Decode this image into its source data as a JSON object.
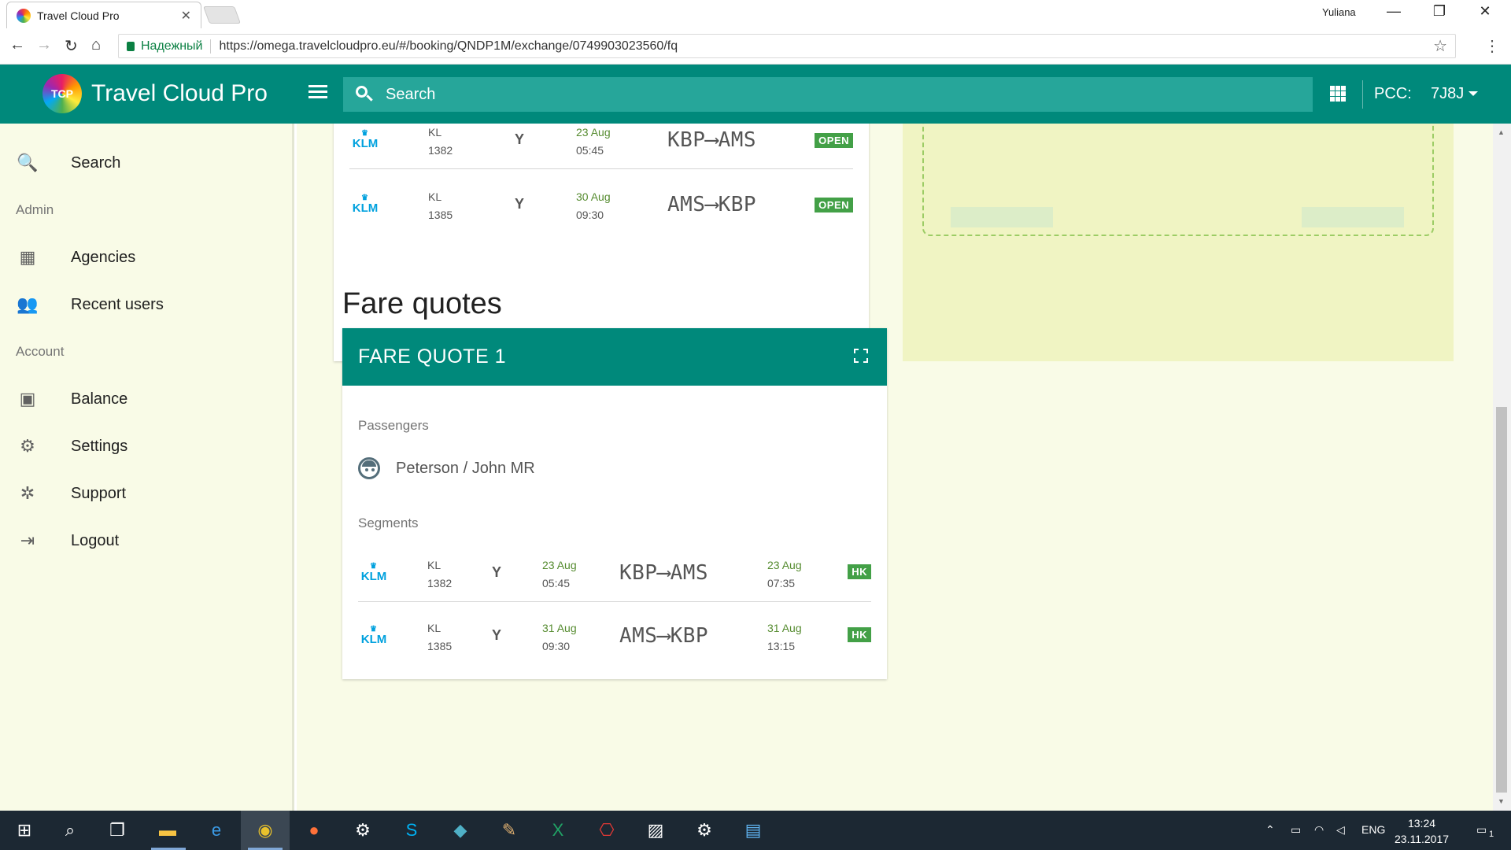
{
  "browser": {
    "tab_title": "Travel Cloud Pro",
    "tab_close": "✕",
    "user": "Yuliana",
    "secure_label": "Надежный",
    "url": "https://omega.travelcloudpro.eu/#/booking/QNDP1M/exchange/0749903023560/fq",
    "controls": {
      "minimize": "—",
      "restore": "❐",
      "close": "✕",
      "back": "←",
      "forward": "→",
      "reload": "↻",
      "home": "⌂",
      "star": "☆",
      "menu": "⋮"
    }
  },
  "header": {
    "logo_text": "TCP",
    "title": "Travel Cloud Pro",
    "search_placeholder": "Search",
    "pcc_label": "PCC:",
    "pcc_value": "7J8J"
  },
  "sidebar": {
    "search": "Search",
    "admin_section": "Admin",
    "agencies": "Agencies",
    "recent_users": "Recent users",
    "account_section": "Account",
    "balance": "Balance",
    "settings": "Settings",
    "support": "Support",
    "logout": "Logout",
    "icons": {
      "search": "🔍",
      "agencies": "▦",
      "recent_users": "👥",
      "balance": "▣",
      "settings": "⚙",
      "support": "✲",
      "logout": "⇥"
    }
  },
  "top_segments": [
    {
      "airline": "KLM",
      "carrier": "KL",
      "flight": "1382",
      "cabin": "Y",
      "date": "23 Aug",
      "time": "05:45",
      "route": "KBP⟶AMS",
      "status": "OPEN"
    },
    {
      "airline": "KLM",
      "carrier": "KL",
      "flight": "1385",
      "cabin": "Y",
      "date": "30 Aug",
      "time": "09:30",
      "route": "AMS⟶KBP",
      "status": "OPEN"
    }
  ],
  "fare_quotes": {
    "heading": "Fare quotes",
    "quote_title": "FARE QUOTE 1",
    "passengers_label": "Passengers",
    "passenger": "Peterson / John MR",
    "segments_label": "Segments",
    "segments": [
      {
        "airline": "KLM",
        "carrier": "KL",
        "flight": "1382",
        "cabin": "Y",
        "dep_date": "23 Aug",
        "dep_time": "05:45",
        "route": "KBP⟶AMS",
        "arr_date": "23 Aug",
        "arr_time": "07:35",
        "status": "HK"
      },
      {
        "airline": "KLM",
        "carrier": "KL",
        "flight": "1385",
        "cabin": "Y",
        "dep_date": "31 Aug",
        "dep_time": "09:30",
        "route": "AMS⟶KBP",
        "arr_date": "31 Aug",
        "arr_time": "13:15",
        "status": "HK"
      }
    ]
  },
  "taskbar": {
    "lang": "ENG",
    "time": "13:24",
    "date": "23.11.2017",
    "notifications": "1"
  },
  "colors": {
    "primary": "#00897b",
    "background": "#f9fbe7",
    "status_green": "#43a047",
    "klm_blue": "#00a1de"
  }
}
